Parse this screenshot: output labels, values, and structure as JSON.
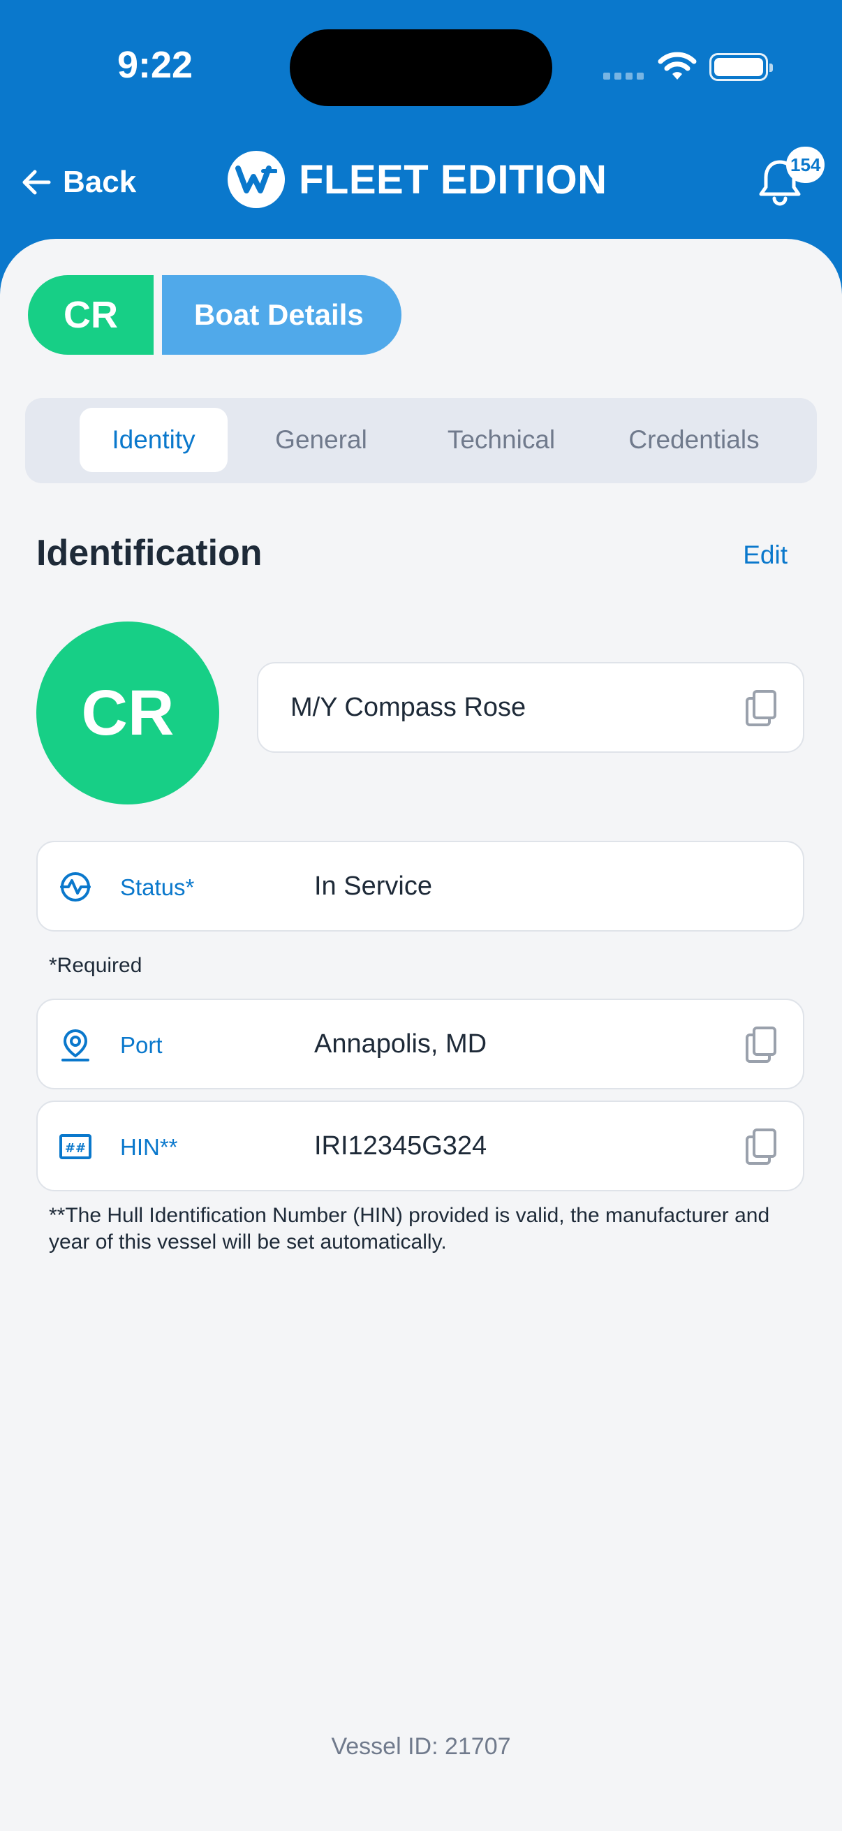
{
  "status_bar": {
    "time": "9:22"
  },
  "nav": {
    "back_label": "Back",
    "brand_text": "FLEET EDITION",
    "notification_count": "154"
  },
  "header": {
    "vessel_abbr": "CR",
    "title": "Boat Details"
  },
  "tabs": [
    {
      "label": "Identity",
      "active": true
    },
    {
      "label": "General",
      "active": false
    },
    {
      "label": "Technical",
      "active": false
    },
    {
      "label": "Credentials",
      "active": false
    }
  ],
  "identification": {
    "section_title": "Identification",
    "edit_label": "Edit",
    "avatar_text": "CR",
    "vessel_name": "M/Y Compass Rose",
    "fields": {
      "status": {
        "label": "Status*",
        "value": "In Service",
        "icon": "activity-icon"
      },
      "port": {
        "label": "Port",
        "value": "Annapolis, MD",
        "icon": "location-pin-icon"
      },
      "hin": {
        "label": "HIN**",
        "value": "IRI12345G324",
        "icon": "hash-icon"
      }
    },
    "required_note": "*Required",
    "hin_note": "**The Hull Identification Number (HIN) provided is valid, the manufacturer and year of this vessel will be set automatically."
  },
  "footer": {
    "vessel_id": "Vessel ID: 21707"
  },
  "colors": {
    "brand_blue": "#0A78CC",
    "accent_green": "#17CF86",
    "light_blue": "#50A9EA",
    "background": "#F4F5F7"
  }
}
